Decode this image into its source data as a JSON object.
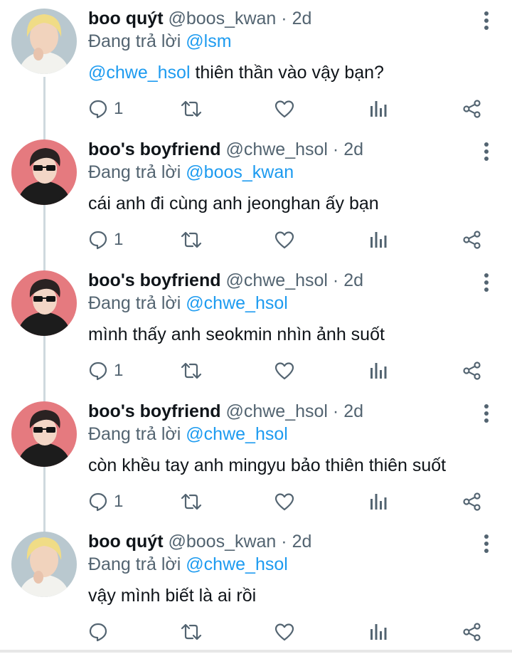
{
  "reply_prefix": "Đang trả lời",
  "colors": {
    "accent": "#1d9bf0",
    "secondary_text": "#536471",
    "thread_line": "#cfd9de",
    "avatar_boo_bg": "#b9c8cf",
    "avatar_boyfriend_bg": "#e57a7f"
  },
  "icons": [
    "more-vertical-icon",
    "reply-icon",
    "retweet-icon",
    "like-icon",
    "analytics-icon",
    "share-icon"
  ],
  "tweets": [
    {
      "display_name": "boo quýt",
      "handle": "@boos_kwan",
      "dot": "·",
      "time": "2d",
      "reply_to": "@lsm",
      "mention": "@chwe_hsol",
      "text": " thiên thần vào vậy bạn?",
      "reply_count": "1",
      "avatar": "boo"
    },
    {
      "display_name": "boo's boyfriend",
      "handle": "@chwe_hsol",
      "dot": "·",
      "time": "2d",
      "reply_to": "@boos_kwan",
      "mention": "",
      "text": "cái anh đi cùng anh jeonghan ấy bạn",
      "reply_count": "1",
      "avatar": "boyfriend"
    },
    {
      "display_name": "boo's boyfriend",
      "handle": "@chwe_hsol",
      "dot": "·",
      "time": "2d",
      "reply_to": "@chwe_hsol",
      "mention": "",
      "text": "mình thấy anh seokmin nhìn ảnh suốt",
      "reply_count": "1",
      "avatar": "boyfriend"
    },
    {
      "display_name": "boo's boyfriend",
      "handle": "@chwe_hsol",
      "dot": "·",
      "time": "2d",
      "reply_to": "@chwe_hsol",
      "mention": "",
      "text": "còn khều tay anh mingyu bảo thiên thiên suốt",
      "reply_count": "1",
      "avatar": "boyfriend"
    },
    {
      "display_name": "boo quýt",
      "handle": "@boos_kwan",
      "dot": "·",
      "time": "2d",
      "reply_to": "@chwe_hsol",
      "mention": "",
      "text": "vậy mình biết là ai rồi",
      "reply_count": "",
      "avatar": "boo"
    }
  ]
}
